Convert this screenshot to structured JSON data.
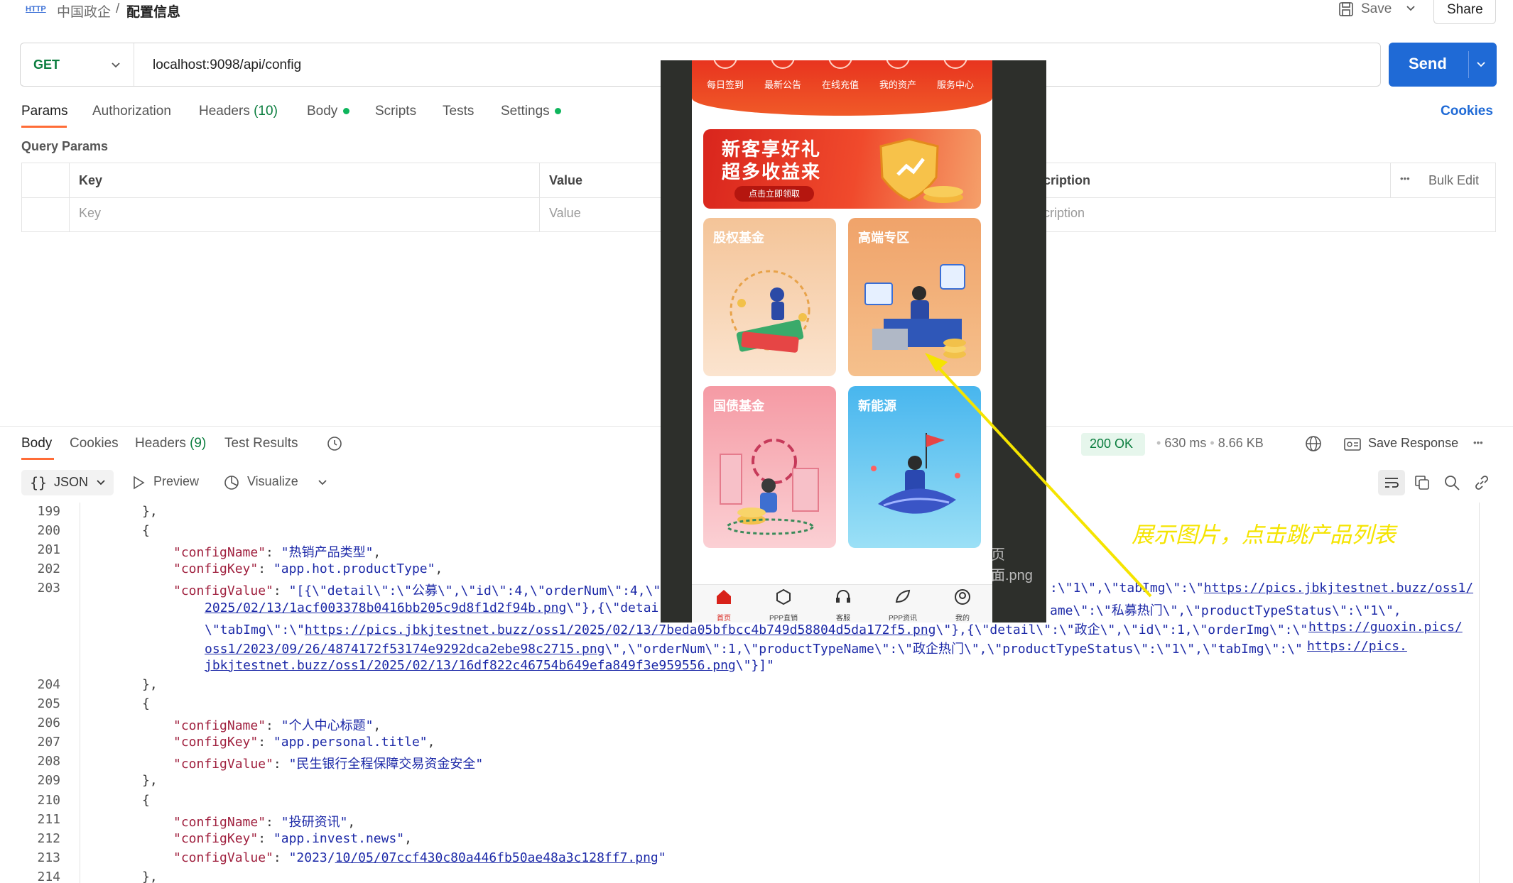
{
  "topbar": {
    "app_badge": "HTTP",
    "breadcrumb_parent": "中国政企",
    "breadcrumb_sep": "/",
    "breadcrumb_current": "配置信息",
    "save_label": "Save",
    "share_label": "Share"
  },
  "request": {
    "method": "GET",
    "url": "localhost:9098/api/config",
    "send_label": "Send"
  },
  "request_tabs": {
    "params": "Params",
    "authorization": "Authorization",
    "headers": "Headers",
    "headers_count": "(10)",
    "body": "Body",
    "scripts": "Scripts",
    "tests": "Tests",
    "settings": "Settings",
    "cookies": "Cookies"
  },
  "query_params": {
    "title": "Query Params",
    "col_key": "Key",
    "col_value": "Value",
    "col_description": "cription",
    "bulk_edit": "Bulk Edit",
    "more": "•••",
    "ph_key": "Key",
    "ph_value": "Value",
    "ph_description": "cription"
  },
  "response_tabs": {
    "body": "Body",
    "cookies": "Cookies",
    "headers": "Headers",
    "headers_count": "(9)",
    "test_results": "Test Results",
    "status": "200 OK",
    "time": "630 ms",
    "size": "8.66 KB",
    "save_response": "Save Response",
    "more": "•••"
  },
  "response_toolbar": {
    "format": "JSON",
    "preview": "Preview",
    "visualize": "Visualize"
  },
  "code_lines": [
    {
      "n": "199",
      "parts": [
        {
          "t": "},",
          "c": "p"
        }
      ],
      "indent": 0
    },
    {
      "n": "200",
      "parts": [
        {
          "t": "{",
          "c": "p"
        }
      ],
      "indent": 0
    },
    {
      "n": "201",
      "parts": [
        {
          "t": "\"configName\"",
          "c": "k"
        },
        {
          "t": ": ",
          "c": "p"
        },
        {
          "t": "\"热销产品类型\"",
          "c": "s"
        },
        {
          "t": ",",
          "c": "p"
        }
      ],
      "indent": 1
    },
    {
      "n": "202",
      "parts": [
        {
          "t": "\"configKey\"",
          "c": "k"
        },
        {
          "t": ": ",
          "c": "p"
        },
        {
          "t": "\"app.hot.productType\"",
          "c": "s"
        },
        {
          "t": ",",
          "c": "p"
        }
      ],
      "indent": 1
    },
    {
      "n": "203",
      "parts": [
        {
          "t": "\"configValue\"",
          "c": "k"
        },
        {
          "t": ": ",
          "c": "p"
        },
        {
          "t": "\"[{\\\"detail\\\":\\\"公募\\\",\\\"id\\\":4,\\\"orderNum\\\":4,\\\"",
          "c": "s"
        }
      ],
      "indent": 1
    }
  ],
  "code_203_right": ":\\\"1\\\",\\\"tabImg\\\":\\\"",
  "code_203_right_url": "https://pics.jbkjtestnet.buzz/oss1/",
  "code_203_cont": [
    {
      "pre": "",
      "url": "2025/02/13/1acf003378b0416bb205c9d8f1d2f94b.png",
      "post": "\\\"},{\\\"detai"
    },
    {
      "pre": "\\\"tabImg\\\":\\\"",
      "url": "https://pics.jbkjtestnet.buzz/oss1/2025/02/13/7beda05bfbcc4b749d58804d5da172f5.png",
      "post": "\\\"},{\\\"detail\\\":\\\"政企\\\",\\\"id\\\":1,\\\"orderImg\\\":\\\""
    },
    {
      "pre": "",
      "url": "oss1/2023/09/26/4874172f53174e9292dca2ebe98c2715.png",
      "post": "\\\",\\\"orderNum\\\":1,\\\"productTypeName\\\":\\\"政企热门\\\",\\\"productTypeStatus\\\":\\\"1\\\",\\\"tabImg\\\":\\\""
    },
    {
      "pre": "",
      "url": "jbkjtestnet.buzz/oss1/2025/02/13/16df822c46754b649efa849f3e959556.png",
      "post": "\\\"}]\""
    }
  ],
  "code_203_cont_right": [
    "ame\\\":\\\"私募热门\\\",\\\"productTypeStatus\\\":\\\"1\\\",",
    "https://guoxin.pics/",
    "https://pics."
  ],
  "code_lines_after": [
    {
      "n": "204",
      "parts": [
        {
          "t": "},",
          "c": "p"
        }
      ],
      "indent": 0
    },
    {
      "n": "205",
      "parts": [
        {
          "t": "{",
          "c": "p"
        }
      ],
      "indent": 0
    },
    {
      "n": "206",
      "parts": [
        {
          "t": "\"configName\"",
          "c": "k"
        },
        {
          "t": ": ",
          "c": "p"
        },
        {
          "t": "\"个人中心标题\"",
          "c": "s"
        },
        {
          "t": ",",
          "c": "p"
        }
      ],
      "indent": 1
    },
    {
      "n": "207",
      "parts": [
        {
          "t": "\"configKey\"",
          "c": "k"
        },
        {
          "t": ": ",
          "c": "p"
        },
        {
          "t": "\"app.personal.title\"",
          "c": "s"
        },
        {
          "t": ",",
          "c": "p"
        }
      ],
      "indent": 1
    },
    {
      "n": "208",
      "parts": [
        {
          "t": "\"configValue\"",
          "c": "k"
        },
        {
          "t": ": ",
          "c": "p"
        },
        {
          "t": "\"民生银行全程保障交易资金安全\"",
          "c": "s"
        }
      ],
      "indent": 1
    },
    {
      "n": "209",
      "parts": [
        {
          "t": "},",
          "c": "p"
        }
      ],
      "indent": 0
    },
    {
      "n": "210",
      "parts": [
        {
          "t": "{",
          "c": "p"
        }
      ],
      "indent": 0
    },
    {
      "n": "211",
      "parts": [
        {
          "t": "\"configName\"",
          "c": "k"
        },
        {
          "t": ": ",
          "c": "p"
        },
        {
          "t": "\"投研资讯\"",
          "c": "s"
        },
        {
          "t": ",",
          "c": "p"
        }
      ],
      "indent": 1
    },
    {
      "n": "212",
      "parts": [
        {
          "t": "\"configKey\"",
          "c": "k"
        },
        {
          "t": ": ",
          "c": "p"
        },
        {
          "t": "\"app.invest.news\"",
          "c": "s"
        },
        {
          "t": ",",
          "c": "p"
        }
      ],
      "indent": 1
    },
    {
      "n": "213",
      "parts": [
        {
          "t": "\"configValue\"",
          "c": "k"
        },
        {
          "t": ": ",
          "c": "p"
        },
        {
          "t": "\"2023/",
          "c": "s"
        },
        {
          "t": "10/05/07ccf430c80a446fb50ae48a3c128ff7.png",
          "c": "u"
        },
        {
          "t": "\"",
          "c": "s"
        }
      ],
      "indent": 1
    },
    {
      "n": "214",
      "parts": [
        {
          "t": "},",
          "c": "p"
        }
      ],
      "indent": 0
    }
  ],
  "phone": {
    "quick_menu": [
      "每日签到",
      "最新公告",
      "在线充值",
      "我的资产",
      "服务中心"
    ],
    "banner_line1": "新客享好礼",
    "banner_line2": "超多收益来",
    "banner_button": "点击立即领取",
    "cards": [
      "股权基金",
      "高端专区",
      "国债基金",
      "新能源"
    ],
    "nav": [
      "首页",
      "PPP直销",
      "客服",
      "PPP资讯",
      "我的"
    ],
    "side_text": "页面.png"
  },
  "annotation": {
    "text": "展示图片，点击跳产品列表",
    "color": "#f5e400"
  },
  "colors": {
    "accent": "#ff6c37",
    "send": "#1f6ad6",
    "status_ok": "#0a7d3e",
    "phone_red": "#e0261b"
  }
}
